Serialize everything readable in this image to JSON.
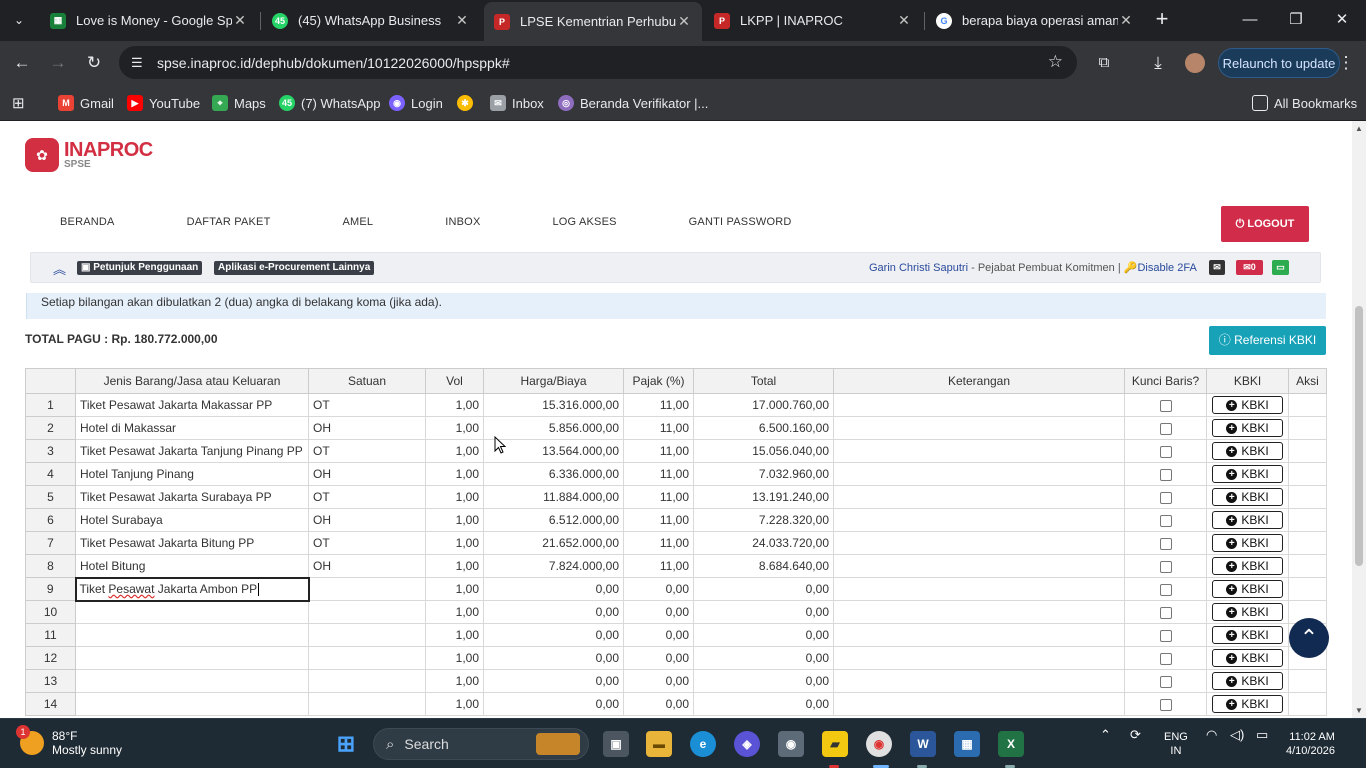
{
  "browser": {
    "tabs": [
      {
        "title": "Love is Money - Google Spre",
        "favicon_color": "#188038",
        "active": false
      },
      {
        "title": "(45) WhatsApp Business",
        "favicon_color": "#25d366",
        "favicon_text": "45",
        "active": false
      },
      {
        "title": "LPSE Kementrian Perhubung",
        "favicon_color": "#c62828",
        "active": true
      },
      {
        "title": "LKPP | INAPROC",
        "favicon_color": "#c62828",
        "active": false
      },
      {
        "title": "berapa biaya operasi amand",
        "favicon_color": "#ffffff",
        "favicon_text": "G",
        "active": false
      }
    ],
    "url": "spse.inaproc.id/dephub/dokumen/10122026000/hpsppk#",
    "relaunch_label": "Relaunch to update",
    "bookmarks": [
      {
        "label": "Gmail",
        "color": "#ea4335"
      },
      {
        "label": "YouTube",
        "color": "#ff0000"
      },
      {
        "label": "Maps",
        "color": "#34a853"
      },
      {
        "label": "(7) WhatsApp",
        "color": "#25d366",
        "icon_text": "45"
      },
      {
        "label": "Login",
        "color": "#7b61ff"
      },
      {
        "label": "",
        "color": "#fbbc04"
      },
      {
        "label": "Inbox",
        "color": "#9aa0a6"
      },
      {
        "label": "Beranda Verifikator |...",
        "color": "#8e6dbf"
      }
    ],
    "all_bookmarks": "All Bookmarks"
  },
  "site": {
    "logo_text": "INAPROC",
    "logo_sub": "SPSE",
    "nav": [
      "BERANDA",
      "DAFTAR PAKET",
      "AMEL",
      "INBOX",
      "LOG AKSES",
      "GANTI PASSWORD"
    ],
    "logout": "LOGOUT",
    "subbar": {
      "petunjuk": "Petunjuk Penggunaan",
      "aplikasi": "Aplikasi e-Procurement Lainnya",
      "user_name": "Garin Christi Saputri",
      "user_role": " - Pejabat Pembuat Komitmen | ",
      "disable_2fa": "Disable 2FA",
      "mail_count": "0"
    },
    "notice": "Setiap bilangan akan dibulatkan 2 (dua) angka di belakang koma (jika ada).",
    "total_pagu": "TOTAL PAGU : Rp. 180.772.000,00",
    "referensi_btn": "Referensi KBKI"
  },
  "table": {
    "headers": [
      "",
      "Jenis Barang/Jasa atau Keluaran",
      "Satuan",
      "Vol",
      "Harga/Biaya",
      "Pajak (%)",
      "Total",
      "Keterangan",
      "Kunci Baris?",
      "KBKI",
      "Aksi"
    ],
    "kbki_label": "KBKI",
    "rows": [
      {
        "no": "1",
        "jenis": "Tiket Pesawat Jakarta Makassar PP",
        "satuan": "OT",
        "vol": "1,00",
        "harga": "15.316.000,00",
        "pajak": "11,00",
        "total": "17.000.760,00"
      },
      {
        "no": "2",
        "jenis": "Hotel di Makassar",
        "satuan": "OH",
        "vol": "1,00",
        "harga": "5.856.000,00",
        "pajak": "11,00",
        "total": "6.500.160,00"
      },
      {
        "no": "3",
        "jenis": "Tiket Pesawat Jakarta Tanjung Pinang PP",
        "satuan": "OT",
        "vol": "1,00",
        "harga": "13.564.000,00",
        "pajak": "11,00",
        "total": "15.056.040,00"
      },
      {
        "no": "4",
        "jenis": "Hotel Tanjung Pinang",
        "satuan": "OH",
        "vol": "1,00",
        "harga": "6.336.000,00",
        "pajak": "11,00",
        "total": "7.032.960,00"
      },
      {
        "no": "5",
        "jenis": "Tiket Pesawat Jakarta Surabaya PP",
        "satuan": "OT",
        "vol": "1,00",
        "harga": "11.884.000,00",
        "pajak": "11,00",
        "total": "13.191.240,00"
      },
      {
        "no": "6",
        "jenis": "Hotel Surabaya",
        "satuan": "OH",
        "vol": "1,00",
        "harga": "6.512.000,00",
        "pajak": "11,00",
        "total": "7.228.320,00"
      },
      {
        "no": "7",
        "jenis": "Tiket Pesawat Jakarta Bitung PP",
        "satuan": "OT",
        "vol": "1,00",
        "harga": "21.652.000,00",
        "pajak": "11,00",
        "total": "24.033.720,00"
      },
      {
        "no": "8",
        "jenis": "Hotel Bitung",
        "satuan": "OH",
        "vol": "1,00",
        "harga": "7.824.000,00",
        "pajak": "11,00",
        "total": "8.684.640,00"
      },
      {
        "no": "9",
        "jenis": "Tiket Pesawat Jakarta Ambon PP",
        "satuan": "",
        "vol": "1,00",
        "harga": "0,00",
        "pajak": "0,00",
        "total": "0,00",
        "editing": true
      },
      {
        "no": "10",
        "jenis": "",
        "satuan": "",
        "vol": "1,00",
        "harga": "0,00",
        "pajak": "0,00",
        "total": "0,00"
      },
      {
        "no": "11",
        "jenis": "",
        "satuan": "",
        "vol": "1,00",
        "harga": "0,00",
        "pajak": "0,00",
        "total": "0,00"
      },
      {
        "no": "12",
        "jenis": "",
        "satuan": "",
        "vol": "1,00",
        "harga": "0,00",
        "pajak": "0,00",
        "total": "0,00"
      },
      {
        "no": "13",
        "jenis": "",
        "satuan": "",
        "vol": "1,00",
        "harga": "0,00",
        "pajak": "0,00",
        "total": "0,00"
      },
      {
        "no": "14",
        "jenis": "",
        "satuan": "",
        "vol": "1,00",
        "harga": "0,00",
        "pajak": "0,00",
        "total": "0,00"
      }
    ]
  },
  "taskbar": {
    "weather_temp": "88°F",
    "weather_desc": "Mostly sunny",
    "weather_badge": "1",
    "search_placeholder": "Search",
    "lang_top": "ENG",
    "lang_bottom": "IN",
    "time": "11:02 AM",
    "date": "4/10/2026"
  }
}
